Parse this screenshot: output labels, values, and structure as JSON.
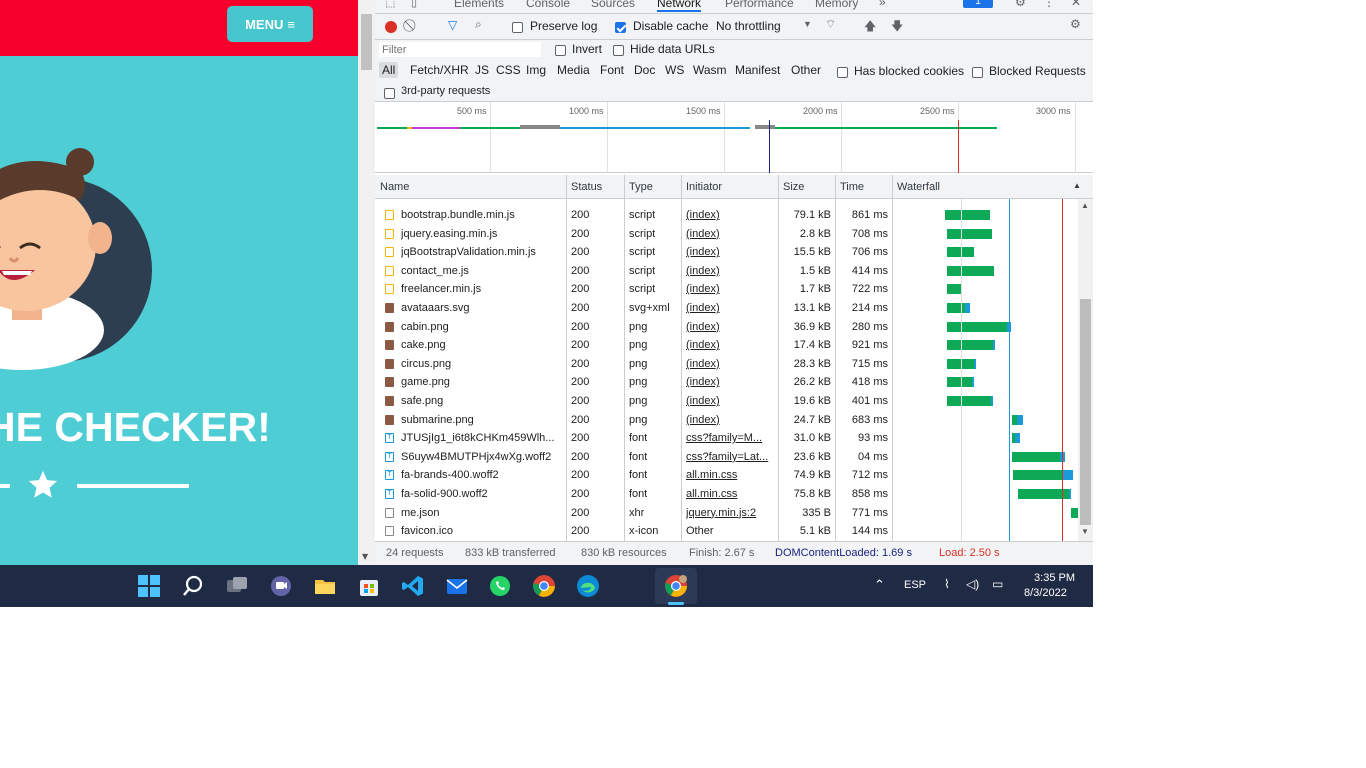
{
  "site": {
    "menu_label": "MENU",
    "hero_text": "HE CHECKER!",
    "accent": "#4ecdd4",
    "nav_color": "#f6002b"
  },
  "devtools": {
    "tabs": [
      "Elements",
      "Console",
      "Sources",
      "Network",
      "Performance",
      "Memory"
    ],
    "active_tab": "Network",
    "issues_count": "1",
    "toolbar": {
      "preserve_log": "Preserve log",
      "disable_cache": "Disable cache",
      "throttling": "No throttling"
    },
    "filter": {
      "placeholder": "Filter",
      "invert": "Invert",
      "hide_data_urls": "Hide data URLs",
      "types": [
        "All",
        "Fetch/XHR",
        "JS",
        "CSS",
        "Img",
        "Media",
        "Font",
        "Doc",
        "WS",
        "Wasm",
        "Manifest",
        "Other"
      ],
      "blocked_cookies": "Has blocked cookies",
      "blocked_requests": "Blocked Requests",
      "third_party": "3rd-party requests"
    },
    "overview_ticks": [
      "500 ms",
      "1000 ms",
      "1500 ms",
      "2000 ms",
      "2500 ms",
      "3000 ms"
    ],
    "columns": [
      "Name",
      "Status",
      "Type",
      "Initiator",
      "Size",
      "Time",
      "Waterfall"
    ],
    "rows": [
      {
        "name": "bootstrap.bundle.min.js",
        "status": "200",
        "type": "script",
        "initiator": "(index)",
        "size": "79.1 kB",
        "time": "861 ms",
        "icon": "script"
      },
      {
        "name": "jquery.easing.min.js",
        "status": "200",
        "type": "script",
        "initiator": "(index)",
        "size": "2.8 kB",
        "time": "708 ms",
        "icon": "script"
      },
      {
        "name": "jqBootstrapValidation.min.js",
        "status": "200",
        "type": "script",
        "initiator": "(index)",
        "size": "15.5 kB",
        "time": "706 ms",
        "icon": "script"
      },
      {
        "name": "contact_me.js",
        "status": "200",
        "type": "script",
        "initiator": "(index)",
        "size": "1.5 kB",
        "time": "414 ms",
        "icon": "script"
      },
      {
        "name": "freelancer.min.js",
        "status": "200",
        "type": "script",
        "initiator": "(index)",
        "size": "1.7 kB",
        "time": "722 ms",
        "icon": "script"
      },
      {
        "name": "avataaars.svg",
        "status": "200",
        "type": "svg+xml",
        "initiator": "(index)",
        "size": "13.1 kB",
        "time": "214 ms",
        "icon": "img"
      },
      {
        "name": "cabin.png",
        "status": "200",
        "type": "png",
        "initiator": "(index)",
        "size": "36.9 kB",
        "time": "280 ms",
        "icon": "img"
      },
      {
        "name": "cake.png",
        "status": "200",
        "type": "png",
        "initiator": "(index)",
        "size": "17.4 kB",
        "time": "921 ms",
        "icon": "img"
      },
      {
        "name": "circus.png",
        "status": "200",
        "type": "png",
        "initiator": "(index)",
        "size": "28.3 kB",
        "time": "715 ms",
        "icon": "img"
      },
      {
        "name": "game.png",
        "status": "200",
        "type": "png",
        "initiator": "(index)",
        "size": "26.2 kB",
        "time": "418 ms",
        "icon": "img"
      },
      {
        "name": "safe.png",
        "status": "200",
        "type": "png",
        "initiator": "(index)",
        "size": "19.6 kB",
        "time": "401 ms",
        "icon": "img"
      },
      {
        "name": "submarine.png",
        "status": "200",
        "type": "png",
        "initiator": "(index)",
        "size": "24.7 kB",
        "time": "683 ms",
        "icon": "img"
      },
      {
        "name": "JTUSjIg1_i6t8kCHKm459Wlh...",
        "status": "200",
        "type": "font",
        "initiator": "css?family=M...",
        "size": "31.0 kB",
        "time": "93 ms",
        "icon": "font"
      },
      {
        "name": "S6uyw4BMUTPHjx4wXg.woff2",
        "status": "200",
        "type": "font",
        "initiator": "css?family=Lat...",
        "size": "23.6 kB",
        "time": "04 ms",
        "icon": "font"
      },
      {
        "name": "fa-brands-400.woff2",
        "status": "200",
        "type": "font",
        "initiator": "all.min.css",
        "size": "74.9 kB",
        "time": "712 ms",
        "icon": "font"
      },
      {
        "name": "fa-solid-900.woff2",
        "status": "200",
        "type": "font",
        "initiator": "all.min.css",
        "size": "75.8 kB",
        "time": "858 ms",
        "icon": "font"
      },
      {
        "name": "me.json",
        "status": "200",
        "type": "xhr",
        "initiator": "jquery.min.js:2",
        "size": "335 B",
        "time": "771 ms",
        "icon": "doc"
      },
      {
        "name": "favicon.ico",
        "status": "200",
        "type": "x-icon",
        "initiator": "Other",
        "size": "5.1 kB",
        "time": "144 ms",
        "icon": "doc"
      }
    ],
    "status_bar": {
      "requests": "24 requests",
      "transferred": "833 kB transferred",
      "resources": "830 kB resources",
      "finish": "Finish: 2.67 s",
      "dcl": "DOMContentLoaded: 1.69 s",
      "load": "Load: 2.50 s"
    }
  },
  "taskbar": {
    "language": "ESP",
    "time": "3:35 PM",
    "date": "8/3/2022"
  }
}
